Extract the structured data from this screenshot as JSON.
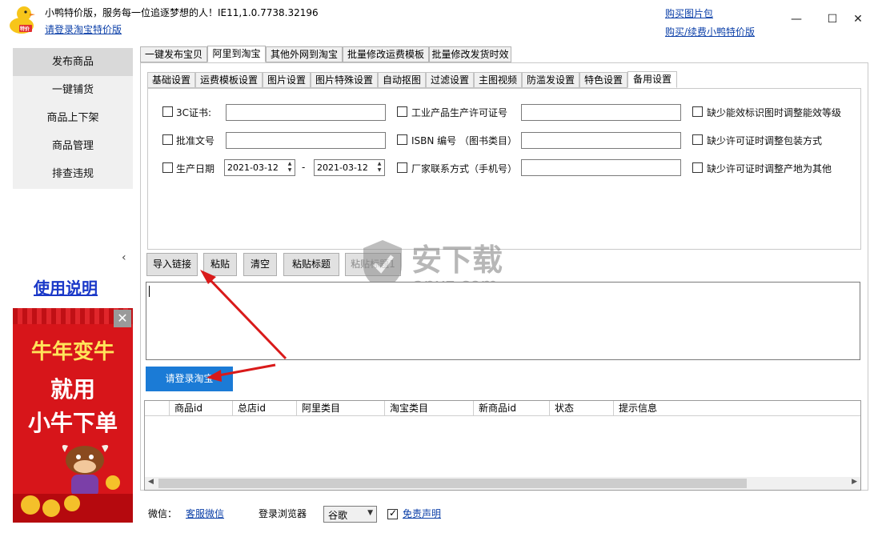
{
  "app": {
    "title": "小鸭特价版，服务每一位追逐梦想的人！IE11,1.0.7738.32196",
    "login_link": "请登录淘宝特价版",
    "buy_pic_link": "购买图片包",
    "buy_renew_link": "购买/续费小鸭特价版",
    "logo_text": "特价"
  },
  "window_controls": {
    "minimize": "—",
    "maximize": "☐",
    "close": "✕"
  },
  "sidebar": {
    "items": [
      {
        "label": "发布商品"
      },
      {
        "label": "一键铺货"
      },
      {
        "label": "商品上下架"
      },
      {
        "label": "商品管理"
      },
      {
        "label": "排查违规"
      }
    ],
    "collapse": "‹",
    "manual": "使用说明"
  },
  "ad": {
    "close": "✕",
    "line1": "牛年变牛",
    "line2": "就用",
    "line3": "小牛下单"
  },
  "tabs": [
    "一键发布宝贝",
    "阿里到淘宝",
    "其他外网到淘宝",
    "批量修改运费模板",
    "批量修改发货时效"
  ],
  "subtabs": [
    "基础设置",
    "运费模板设置",
    "图片设置",
    "图片特殊设置",
    "自动抠图",
    "过滤设置",
    "主图视频",
    "防滥发设置",
    "特色设置",
    "备用设置"
  ],
  "form": {
    "row1": {
      "left_label": "3C证书:",
      "mid_label": "工业产品生产许可证号",
      "right_label": "缺少能效标识图时调整能效等级"
    },
    "row2": {
      "left_label": "批准文号",
      "mid_label": "ISBN 编号 （图书类目）",
      "right_label": "缺少许可证时调整包装方式"
    },
    "row3": {
      "left_label": "生产日期",
      "date_from": "2021-03-12",
      "dash": "-",
      "date_to": "2021-03-12",
      "mid_label": "厂家联系方式（手机号）",
      "right_label": "缺少许可证时调整产地为其他"
    }
  },
  "buttons": {
    "import": "导入链接",
    "paste": "粘贴",
    "clear": "清空",
    "paste_title": "粘贴标题",
    "paste_title1": "粘贴标题1",
    "login_taobao": "请登录淘宝"
  },
  "table": {
    "columns": [
      "商品id",
      "总店id",
      "阿里类目",
      "淘宝类目",
      "新商品id",
      "状态",
      "提示信息"
    ],
    "rows": []
  },
  "footer": {
    "wechat_label": "微信：",
    "wechat_link": "客服微信",
    "browser_label": "登录浏览器",
    "browser_value": "谷歌",
    "disclaimer": "免责声明",
    "disclaimer_checked": true
  },
  "watermark": {
    "brand": "安下载",
    "domain": "anxz.com"
  },
  "colors": {
    "accent": "#1b7bd6",
    "link": "#0b3fa8",
    "ad_red": "#d7151a",
    "arrow": "#d91a1a"
  }
}
